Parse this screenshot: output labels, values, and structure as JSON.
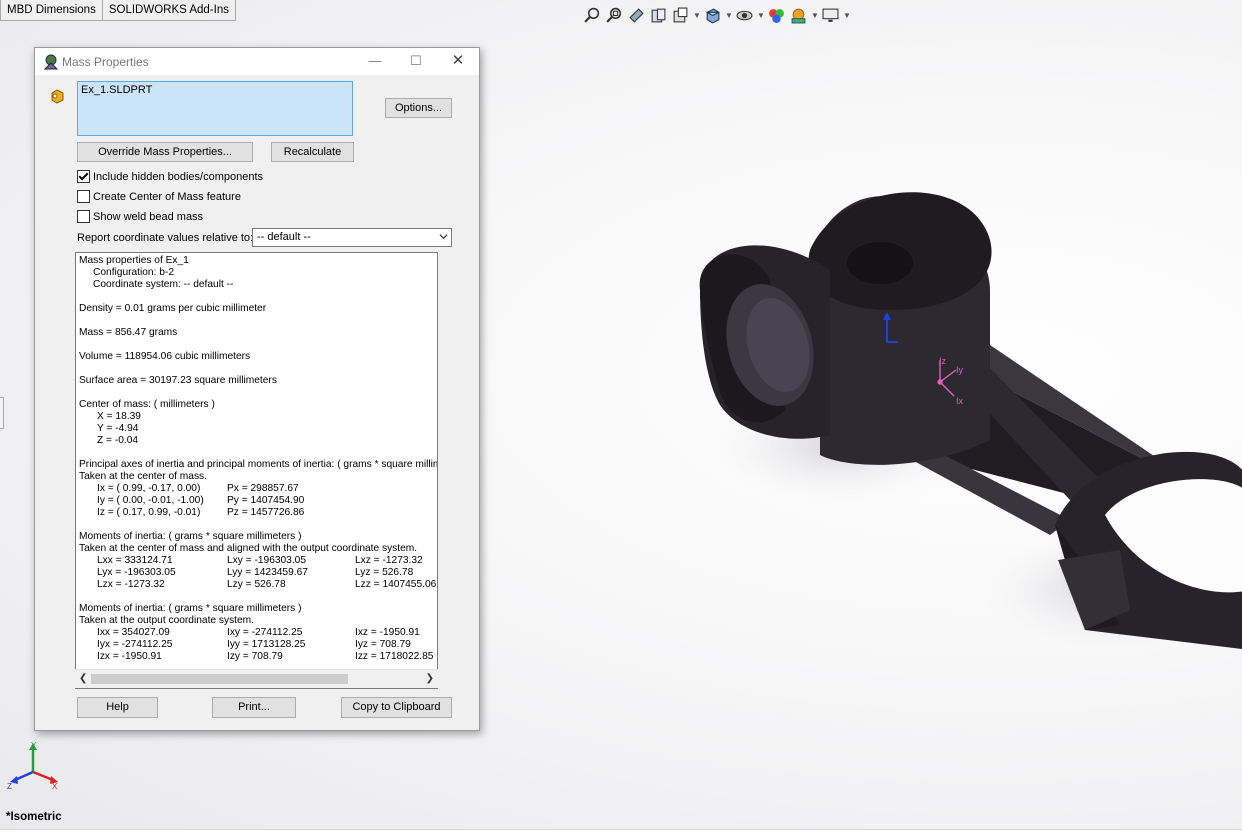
{
  "tabs": [
    {
      "label": "MBD Dimensions"
    },
    {
      "label": "SOLIDWORKS Add-Ins"
    }
  ],
  "heads_up_toolbar": {
    "icons": [
      "zoom-to-fit-icon",
      "zoom-to-area-icon",
      "previous-view-icon",
      "section-view-icon",
      "dynamic-annotation-icon",
      "view-orientation-icon",
      "display-style-icon",
      "hide-show-icon",
      "edit-appearance-icon",
      "apply-scene-icon",
      "view-settings-icon"
    ]
  },
  "dialog": {
    "title": "Mass Properties",
    "selection": "Ex_1.SLDPRT",
    "buttons": {
      "options": "Options...",
      "override": "Override Mass Properties...",
      "recalculate": "Recalculate",
      "help": "Help",
      "print": "Print...",
      "copy": "Copy to Clipboard"
    },
    "checkboxes": {
      "include_hidden": {
        "label": "Include hidden bodies/components",
        "checked": true
      },
      "create_com": {
        "label": "Create Center of Mass feature",
        "checked": false
      },
      "weld_bead": {
        "label": "Show weld bead mass",
        "checked": false
      }
    },
    "report": {
      "label": "Report coordinate values relative to:",
      "selected": "-- default --"
    },
    "results": {
      "header": "Mass properties of Ex_1",
      "configuration": "Configuration: b-2",
      "coord_system": "Coordinate system: -- default --",
      "density": "Density = 0.01 grams per cubic millimeter",
      "mass": "Mass = 856.47 grams",
      "volume": "Volume = 118954.06 cubic millimeters",
      "surface_area": "Surface area = 30197.23  square millimeters",
      "com_header": "Center of mass: ( millimeters )",
      "com_x": "X = 18.39",
      "com_y": "Y = -4.94",
      "com_z": "Z = -0.04",
      "pa_header": "Principal axes of inertia and principal moments of inertia: ( grams *  square millimeters )",
      "pa_taken": "Taken at the center of mass.",
      "pa_rows": [
        {
          "axis": "Ix = ( 0.99, -0.17,  0.00)",
          "moment": "Px = 298857.67"
        },
        {
          "axis": "Iy = ( 0.00, -0.01, -1.00)",
          "moment": "Py = 1407454.90"
        },
        {
          "axis": "Iz = ( 0.17,  0.99, -0.01)",
          "moment": "Pz = 1457726.86"
        }
      ],
      "moi1_header": "Moments of inertia: ( grams *  square millimeters )",
      "moi1_taken": "Taken at the center of mass and aligned with the output coordinate system.",
      "moi1_rows": [
        [
          "Lxx = 333124.71",
          "Lxy = -196303.05",
          "Lxz = -1273.32"
        ],
        [
          "Lyx = -196303.05",
          "Lyy = 1423459.67",
          "Lyz = 526.78"
        ],
        [
          "Lzx = -1273.32",
          "Lzy = 526.78",
          "Lzz = 1407455.06"
        ]
      ],
      "moi2_header": "Moments of inertia: ( grams *  square millimeters )",
      "moi2_taken": "Taken at the output coordinate system.",
      "moi2_rows": [
        [
          "Ixx = 354027.09",
          "Ixy = -274112.25",
          "Ixz = -1950.91"
        ],
        [
          "Iyx = -274112.25",
          "Iyy = 1713128.25",
          "Iyz = 708.79"
        ],
        [
          "Izx = -1950.91",
          "Izy = 708.79",
          "Izz = 1718022.85"
        ]
      ]
    }
  },
  "viewport": {
    "view_name": "*Isometric",
    "triad_labels": {
      "x": "X",
      "y": "Y",
      "z": "Z"
    },
    "com_labels": {
      "x": "Ix",
      "y": "Iy",
      "z": "Iz"
    }
  },
  "colors": {
    "selection_bg": "#cce4f7",
    "part": "#2a272c",
    "triad_x": "#e02020",
    "triad_y": "#20a040",
    "triad_z": "#2040e0"
  }
}
